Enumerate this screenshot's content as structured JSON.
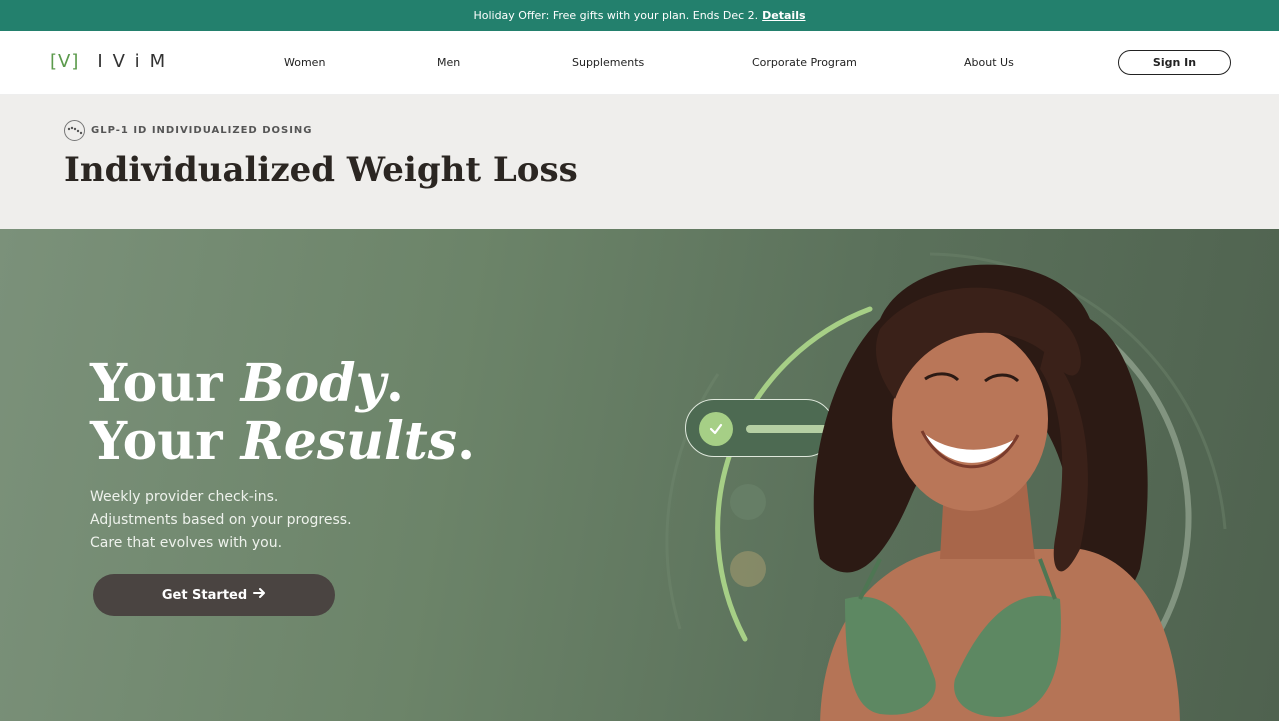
{
  "promo": {
    "text": "Holiday Offer: Free gifts with your plan. Ends Dec 2.",
    "link": "Details"
  },
  "nav": {
    "logo_mark": "[V]",
    "logo_word": "IViM",
    "items": [
      "Women",
      "Men",
      "Supplements",
      "Corporate Program",
      "About Us"
    ],
    "signin": "Sign In"
  },
  "subhead": {
    "eyebrow": "GLP-1 ID INDIVIDUALIZED DOSING",
    "title": "Individualized Weight Loss"
  },
  "hero": {
    "line1_plain": "Your ",
    "line1_italic": "Body",
    "line1_end": ".",
    "line2_plain": "Your ",
    "line2_italic": "Results",
    "line2_end": ".",
    "body": [
      "Weekly provider check-ins.",
      "Adjustments based on your progress.",
      "Care that evolves with you."
    ],
    "cta": "Get Started",
    "cta_icon": "arrow-right-icon"
  },
  "colors": {
    "promo": "#23806d",
    "hero": "#6c8469",
    "accent": "#a6cf86",
    "cta": "#4a4441"
  }
}
